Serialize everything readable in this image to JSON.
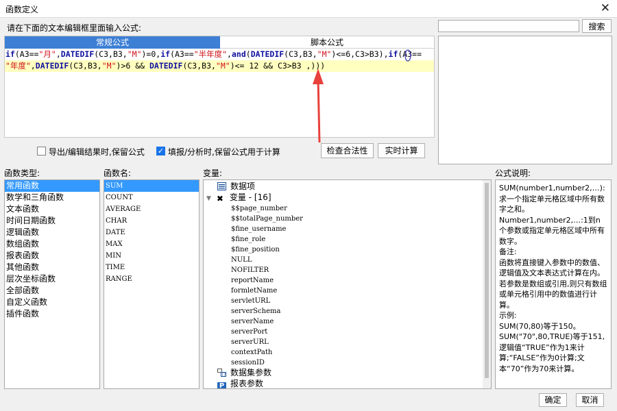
{
  "window": {
    "title": "函数定义"
  },
  "editor": {
    "prompt": "请在下面的文本编辑框里面输入公式:",
    "tabs": [
      {
        "label": "常规公式",
        "active": true
      },
      {
        "label": "脚本公式",
        "active": false
      }
    ],
    "formula_line1": "if(A3==\"月\",DATEDIF(C3,B3,\"M\")=0,if(A3==\"半年度\",and(DATEDIF(C3,B3,\"M\")<=6,C3>B3),if(A3==",
    "formula_line2": "\"年度\",DATEDIF(C3,B3,\"M\")>6 && DATEDIF(C3,B3,\"M\")<= 12 && C3>B3 ,)))"
  },
  "search": {
    "value": "",
    "button": "搜索"
  },
  "options": {
    "export_keep": {
      "label": "导出/编辑结果时,保留公式",
      "checked": false
    },
    "fill_keep": {
      "label": "填报/分析时,保留公式用于计算",
      "checked": true
    },
    "check_button": "检查合法性",
    "realtime_button": "实时计算"
  },
  "panels": {
    "category_label": "函数类型:",
    "function_label": "函数名:",
    "variable_label": "变量:",
    "description_label": "公式说明:"
  },
  "categories": [
    "常用函数",
    "数学和三角函数",
    "文本函数",
    "时间日期函数",
    "逻辑函数",
    "数组函数",
    "报表函数",
    "其他函数",
    "层次坐标函数",
    "全部函数",
    "自定义函数",
    "插件函数"
  ],
  "selected_category": 0,
  "functions": [
    "SUM",
    "COUNT",
    "AVERAGE",
    "CHAR",
    "DATE",
    "MAX",
    "MIN",
    "TIME",
    "RANGE"
  ],
  "selected_function": 0,
  "variables": {
    "data_item": "数据项",
    "variable_group": "变量 - [16]",
    "items": [
      "$$page_number",
      "$$totalPage_number",
      "$fine_username",
      "$fine_role",
      "$fine_position",
      "NULL",
      "NOFILTER",
      "reportName",
      "formletName",
      "servletURL",
      "serverSchema",
      "serverName",
      "serverPort",
      "serverURL",
      "contextPath",
      "sessionID"
    ],
    "dataset_params": "数据集参数",
    "report_params": "报表参数"
  },
  "description": [
    "SUM(number1,number2,…):求一个指定单元格区域中所有数字之和。",
    "Number1,number2,…:1到n个参数或指定单元格区域中所有数字。",
    "备注:",
    "函数将直接键入参数中的数值、逻辑值及文本表达式计算在内。若参数是数组或引用,则只有数组或单元格引用中的数值进行计算。",
    "示例:",
    "SUM(70,80)等于150。",
    "SUM(\"70\",80,TRUE)等于151,逻辑值“TRUE”作为1来计算;“FALSE”作为0计算;文本“70”作为70来计算。"
  ],
  "footer": {
    "ok": "确定",
    "cancel": "取消"
  },
  "colors": {
    "tab_active": "#3d7fd4",
    "selection": "#3399ff",
    "highlight_line": "#ffffc0",
    "arrow": "#e8413c"
  }
}
